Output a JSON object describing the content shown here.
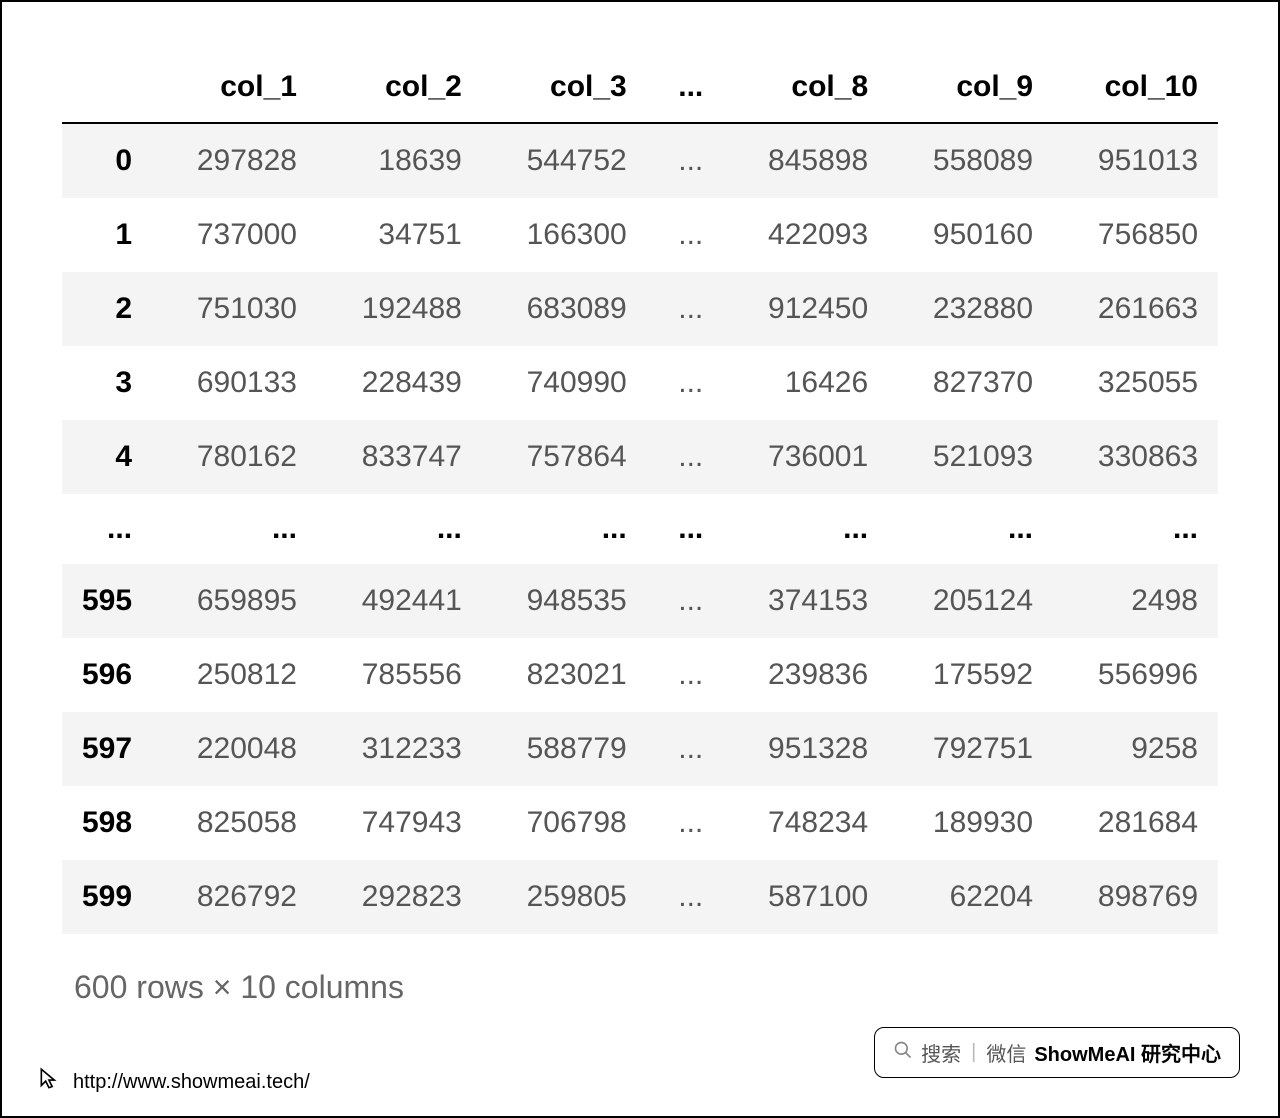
{
  "table": {
    "columns": [
      "",
      "col_1",
      "col_2",
      "col_3",
      "...",
      "col_8",
      "col_9",
      "col_10"
    ],
    "rows": [
      {
        "index": "0",
        "cells": [
          "297828",
          "18639",
          "544752",
          "...",
          "845898",
          "558089",
          "951013"
        ]
      },
      {
        "index": "1",
        "cells": [
          "737000",
          "34751",
          "166300",
          "...",
          "422093",
          "950160",
          "756850"
        ]
      },
      {
        "index": "2",
        "cells": [
          "751030",
          "192488",
          "683089",
          "...",
          "912450",
          "232880",
          "261663"
        ]
      },
      {
        "index": "3",
        "cells": [
          "690133",
          "228439",
          "740990",
          "...",
          "16426",
          "827370",
          "325055"
        ]
      },
      {
        "index": "4",
        "cells": [
          "780162",
          "833747",
          "757864",
          "...",
          "736001",
          "521093",
          "330863"
        ]
      },
      {
        "index": "...",
        "cells": [
          "...",
          "...",
          "...",
          "...",
          "...",
          "...",
          "..."
        ],
        "ellipsis": true
      },
      {
        "index": "595",
        "cells": [
          "659895",
          "492441",
          "948535",
          "...",
          "374153",
          "205124",
          "2498"
        ]
      },
      {
        "index": "596",
        "cells": [
          "250812",
          "785556",
          "823021",
          "...",
          "239836",
          "175592",
          "556996"
        ]
      },
      {
        "index": "597",
        "cells": [
          "220048",
          "312233",
          "588779",
          "...",
          "951328",
          "792751",
          "9258"
        ]
      },
      {
        "index": "598",
        "cells": [
          "825058",
          "747943",
          "706798",
          "...",
          "748234",
          "189930",
          "281684"
        ]
      },
      {
        "index": "599",
        "cells": [
          "826792",
          "292823",
          "259805",
          "...",
          "587100",
          "62204",
          "898769"
        ]
      }
    ],
    "shape_text": "600 rows × 10 columns"
  },
  "footer": {
    "url": "http://www.showmeai.tech/"
  },
  "badge": {
    "search_label": "搜索",
    "wechat_label": "微信",
    "brand": "ShowMeAI 研究中心"
  }
}
